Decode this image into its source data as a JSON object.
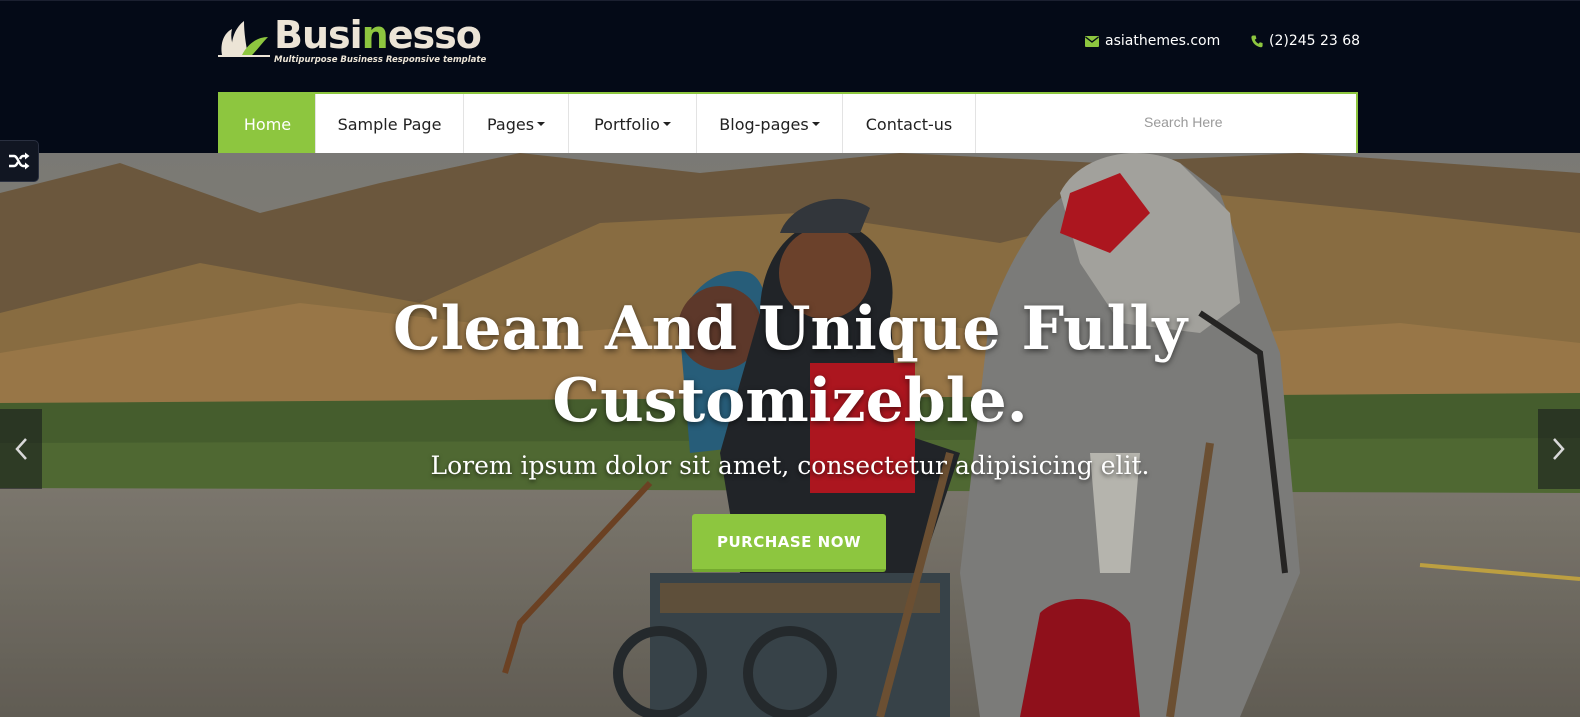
{
  "brand": {
    "name_part1": "Busi",
    "name_accent": "n",
    "name_part2": "esso",
    "tagline": "Multipurpose Business Responsive template",
    "accent_color": "#8dc63f"
  },
  "contact": {
    "email": "asiathemes.com",
    "email_icon": "envelope-icon",
    "phone": "(2)245 23 68",
    "phone_icon": "phone-icon"
  },
  "nav": {
    "items": [
      {
        "label": "Home",
        "active": true,
        "dropdown": false
      },
      {
        "label": "Sample Page",
        "active": false,
        "dropdown": false
      },
      {
        "label": "Pages",
        "active": false,
        "dropdown": true
      },
      {
        "label": "Portfolio",
        "active": false,
        "dropdown": true
      },
      {
        "label": "Blog-pages",
        "active": false,
        "dropdown": true
      },
      {
        "label": "Contact-us",
        "active": false,
        "dropdown": false
      }
    ],
    "search_placeholder": "Search Here"
  },
  "hero": {
    "title_line1": "Clean And Unique Fully",
    "title_line2": "Customizeble.",
    "subtitle": "Lorem ipsum dolor sit amet, consectetur adipisicing elit.",
    "cta_label": "PURCHASE NOW",
    "prev_icon": "chevron-left-icon",
    "next_icon": "chevron-right-icon",
    "shuffle_icon": "shuffle-icon"
  }
}
